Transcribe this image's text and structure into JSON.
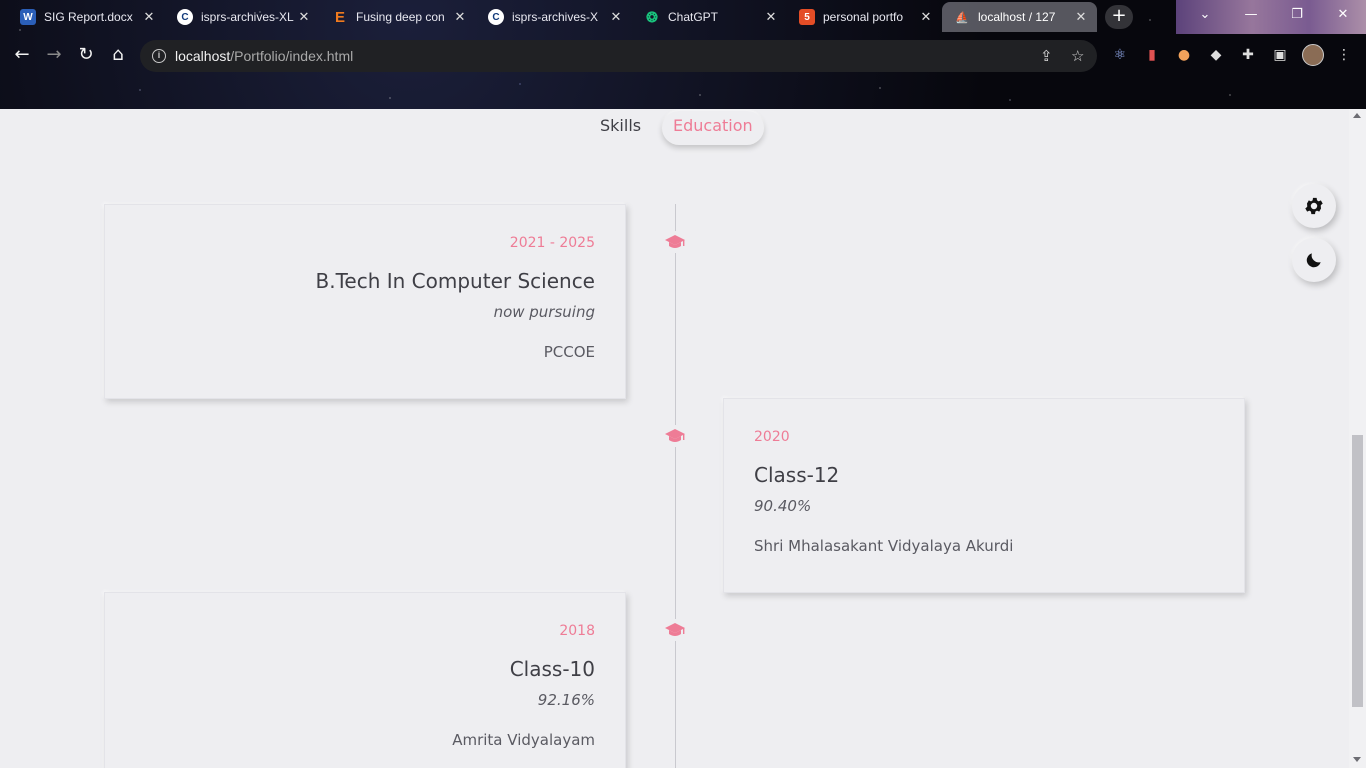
{
  "browser": {
    "tabs": [
      {
        "title": "SIG Report.docx",
        "favicon": "word-icon",
        "color": "#2b5fb8"
      },
      {
        "title": "isprs-archives-XL",
        "favicon": "copernicus-icon",
        "color": "#ffffff"
      },
      {
        "title": "Fusing deep con",
        "favicon": "elsevier-icon",
        "color": "#f07a1e"
      },
      {
        "title": "isprs-archives-X",
        "favicon": "copernicus-icon",
        "color": "#ffffff"
      },
      {
        "title": "ChatGPT",
        "favicon": "chatgpt-icon",
        "color": "#19c37d"
      },
      {
        "title": "personal portfo",
        "favicon": "html5-icon",
        "color": "#e44d26"
      },
      {
        "title": "localhost / 127",
        "favicon": "phpmyadmin-icon",
        "color": "#f29111"
      }
    ],
    "new_tab_label": "+",
    "url_host": "localhost",
    "url_path": "/Portfolio/index.html"
  },
  "qualification_tabs": {
    "skills": "Skills",
    "education": "Education"
  },
  "education": [
    {
      "year": "2021 - 2025",
      "degree": "B.Tech In Computer Science",
      "status": "now pursuing",
      "school": "PCCOE"
    },
    {
      "year": "2020",
      "degree": "Class-12",
      "status": "90.40%",
      "school": "Shri Mhalasakant Vidyalaya Akurdi"
    },
    {
      "year": "2018",
      "degree": "Class-10",
      "status": "92.16%",
      "school": "Amrita Vidyalayam"
    }
  ],
  "accent_color": "#ee7c96"
}
